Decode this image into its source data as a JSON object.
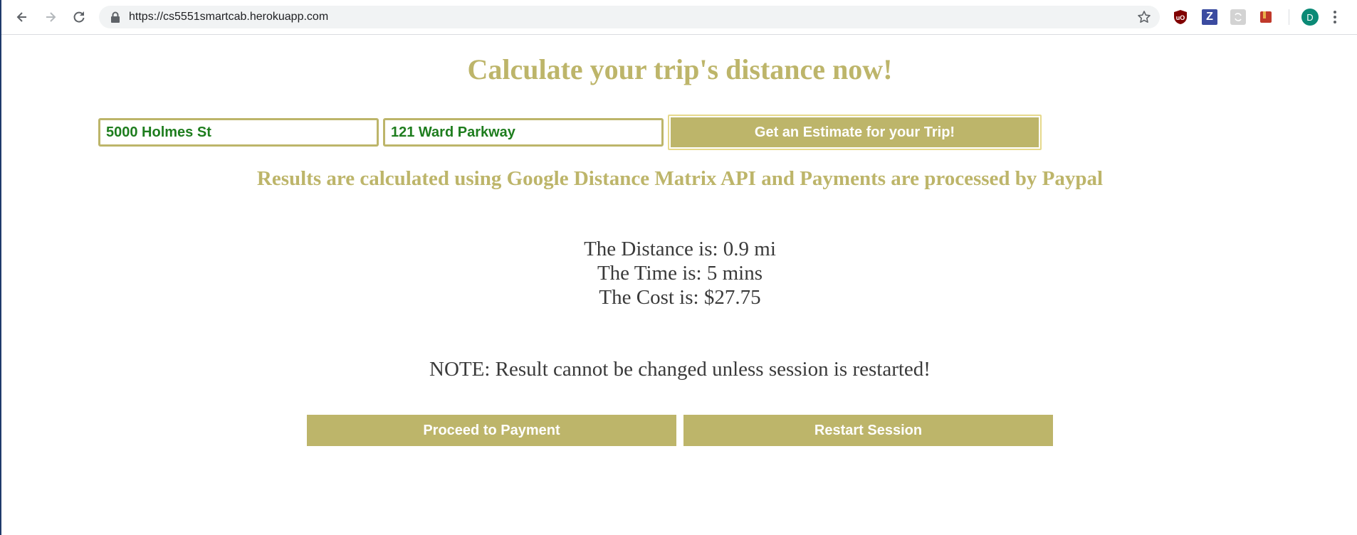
{
  "browser": {
    "url": "https://cs5551smartcab.herokuapp.com",
    "avatar_initial": "D",
    "extensions": [
      {
        "name": "ublock-origin-icon",
        "label": "uO"
      },
      {
        "name": "zotero-icon",
        "label": "Z"
      },
      {
        "name": "sync-extension-icon",
        "label": ""
      },
      {
        "name": "bookmark-extension-icon",
        "label": ""
      }
    ]
  },
  "page": {
    "heading": "Calculate your trip's distance now!",
    "origin_value": "5000 Holmes St",
    "destination_value": "121 Ward Parkway",
    "estimate_button": "Get an Estimate for your Trip!",
    "subtitle": "Results are calculated using Google Distance Matrix API and Payments are processed by Paypal",
    "results": {
      "distance": "The Distance is: 0.9 mi",
      "time": "The Time is: 5 mins",
      "cost": "The Cost is: $27.75"
    },
    "note": "NOTE: Result cannot be changed unless session is restarted!",
    "pay_button": "Proceed to Payment",
    "restart_button": "Restart Session"
  },
  "colors": {
    "accent": "#bdb56a",
    "input_text": "#1e7d1e",
    "body_text": "#3a3a3a"
  }
}
